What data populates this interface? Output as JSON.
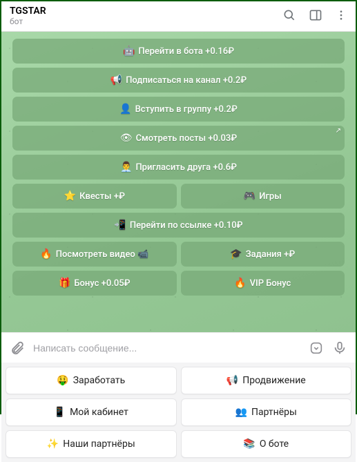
{
  "header": {
    "title": "TGSTAR",
    "subtitle": "бот"
  },
  "inline_buttons": [
    [
      {
        "emoji": "🤖",
        "label": "Перейти в бота +0.16₽"
      }
    ],
    [
      {
        "emoji": "📢",
        "label": "Подписаться на канал +0.2₽"
      }
    ],
    [
      {
        "emoji": "👤",
        "label": "Вступить в группу +0.2₽"
      }
    ],
    [
      {
        "emoji": "👁",
        "label": "Смотреть посты +0.03₽",
        "share": true
      }
    ],
    [
      {
        "emoji": "👨‍💼",
        "label": "Пригласить друга +0.6₽"
      }
    ],
    [
      {
        "emoji": "⭐",
        "label": "Квесты +₽"
      },
      {
        "emoji": "🎮",
        "label": "Игры"
      }
    ],
    [
      {
        "emoji": "📲",
        "label": "Перейти по ссылке +0.10₽"
      }
    ],
    [
      {
        "emoji": "🔥",
        "label": "Посмотреть видео 📹"
      },
      {
        "emoji": "🎓",
        "label": "Задания +₽"
      }
    ],
    [
      {
        "emoji": "🎁",
        "label": "Бонус +0.05₽"
      },
      {
        "emoji": "🔥",
        "label": "VIP Бонус"
      }
    ]
  ],
  "input": {
    "placeholder": "Написать сообщение..."
  },
  "keyboard": [
    [
      {
        "emoji": "🤑",
        "label": "Заработать"
      },
      {
        "emoji": "📢",
        "label": "Продвижение"
      }
    ],
    [
      {
        "emoji": "📱",
        "label": "Мой кабинет"
      },
      {
        "emoji": "👥",
        "label": "Партнёры"
      }
    ],
    [
      {
        "emoji": "✨",
        "label": "Наши партнёры"
      },
      {
        "emoji": "📚",
        "label": "О боте"
      }
    ]
  ]
}
